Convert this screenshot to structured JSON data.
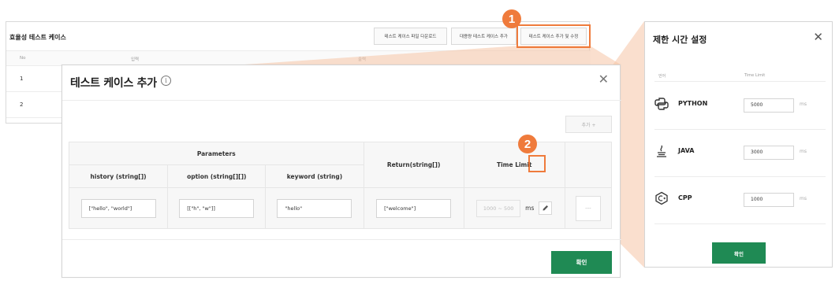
{
  "background_page": {
    "title": "효율성 테스트 케이스",
    "buttons": [
      "테스트 케이스 파일 다운로드",
      "대용량 테스트 케이스 추가",
      "테스트 케이스 추가 및 수정"
    ],
    "columns": [
      "No",
      "입력",
      "출력"
    ],
    "rows": [
      "1",
      "2"
    ]
  },
  "modal": {
    "title": "테스트 케이스 추가",
    "add_button": "추가 +",
    "table": {
      "group_header": "Parameters",
      "param_headers": [
        "history (string[])",
        "option (string[][])",
        "keyword (string)"
      ],
      "return_header": "Return(string[])",
      "time_limit_header": "Time Limit",
      "row": {
        "history": "[\"hello\", \"world\"]",
        "option": "[[\"h\", \"w\"]]",
        "keyword": "\"hello\"",
        "return": "[\"welcome\"]",
        "time_limit_placeholder": "1000 ~ 500",
        "unit": "ms",
        "action": "---"
      }
    },
    "confirm_button": "확인"
  },
  "side_modal": {
    "title": "제한 시간 설정",
    "columns": [
      "언어",
      "Time Limit"
    ],
    "languages": [
      {
        "name": "PYTHON",
        "value": "5000",
        "unit": "ms",
        "icon": "python-icon"
      },
      {
        "name": "JAVA",
        "value": "3000",
        "unit": "ms",
        "icon": "java-icon"
      },
      {
        "name": "CPP",
        "value": "1000",
        "unit": "ms",
        "icon": "cpp-icon"
      }
    ],
    "confirm_button": "확인"
  },
  "markers": [
    "1",
    "2"
  ],
  "colors": {
    "accent": "#ef7b3c",
    "primary": "#1f8a54"
  }
}
